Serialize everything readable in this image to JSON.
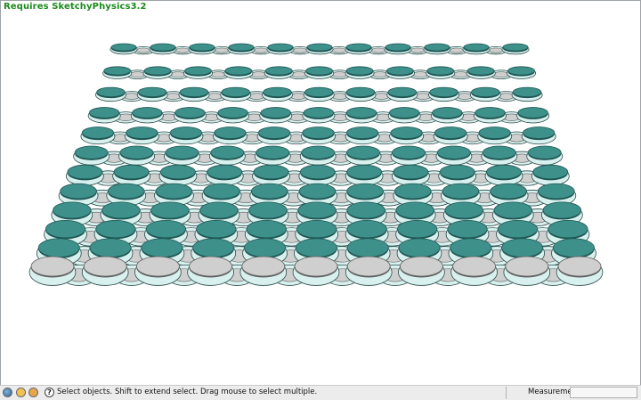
{
  "viewport": {
    "note": "Requires SketchyPhysics3.2",
    "model": {
      "description_icon": "chain-mail-ring-grid",
      "rows": 12,
      "cols": 11,
      "colors": {
        "teal_disc": "#3e908a",
        "teal_disc_edge": "#1f5754",
        "gray_disc": "#cfcfcf",
        "gray_disc_edge": "#606060",
        "ring_fill": "#d8f0ee",
        "ring_edge": "#2d4e4c"
      }
    }
  },
  "status_bar": {
    "icons": [
      "geo-location-icon",
      "credits-icon",
      "user-icon",
      "help-icon"
    ],
    "hint": "Select objects. Shift to extend select. Drag mouse to select multiple.",
    "measurements_label": "Measurements",
    "measurements_value": ""
  }
}
